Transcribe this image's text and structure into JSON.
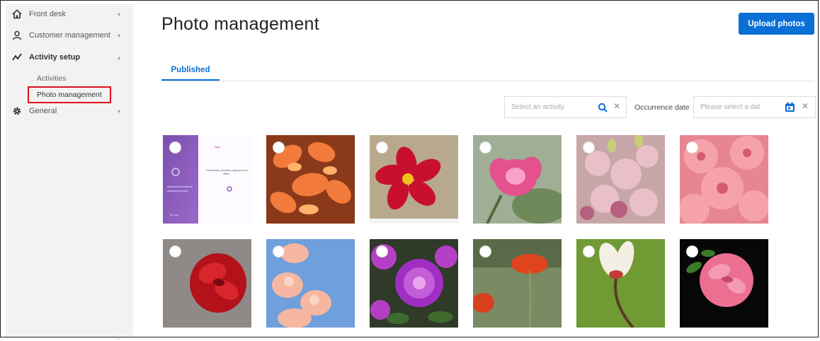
{
  "sidebar": {
    "items": [
      {
        "label": "Front desk",
        "icon": "home-icon"
      },
      {
        "label": "Customer management",
        "icon": "user-icon"
      },
      {
        "label": "Activity setup",
        "icon": "activity-icon"
      },
      {
        "label": "General",
        "icon": "gear-icon"
      }
    ],
    "sub_items": [
      "Activities",
      "Photo management"
    ],
    "active_sub": "Photo management",
    "highlight_color": "#e0101a"
  },
  "main": {
    "title": "Photo management",
    "upload_label": "Upload photos",
    "tabs": [
      {
        "label": "Published",
        "active": true
      }
    ],
    "filters": {
      "activity_placeholder": "Select an activity",
      "date_label": "Occurrence date",
      "date_placeholder": "Please select a dat"
    }
  },
  "screenshot_text": {
    "title_fragment": "login",
    "message": "The internet connection appears to be offline.",
    "footer": "By login"
  },
  "photos": [
    {
      "subject": "app screenshot"
    },
    {
      "subject": "orange clivia"
    },
    {
      "subject": "red cosmos"
    },
    {
      "subject": "pink peony"
    },
    {
      "subject": "pink lisianthus bouquet"
    },
    {
      "subject": "pink gerbera"
    },
    {
      "subject": "red rose"
    },
    {
      "subject": "peach flowers on blue sky"
    },
    {
      "subject": "purple dahlia"
    },
    {
      "subject": "red poppies"
    },
    {
      "subject": "white magnolia bud"
    },
    {
      "subject": "pink rose on black"
    }
  ],
  "colors": {
    "accent": "#0a6fd6",
    "sidebar_bg": "#f2f2f2"
  }
}
